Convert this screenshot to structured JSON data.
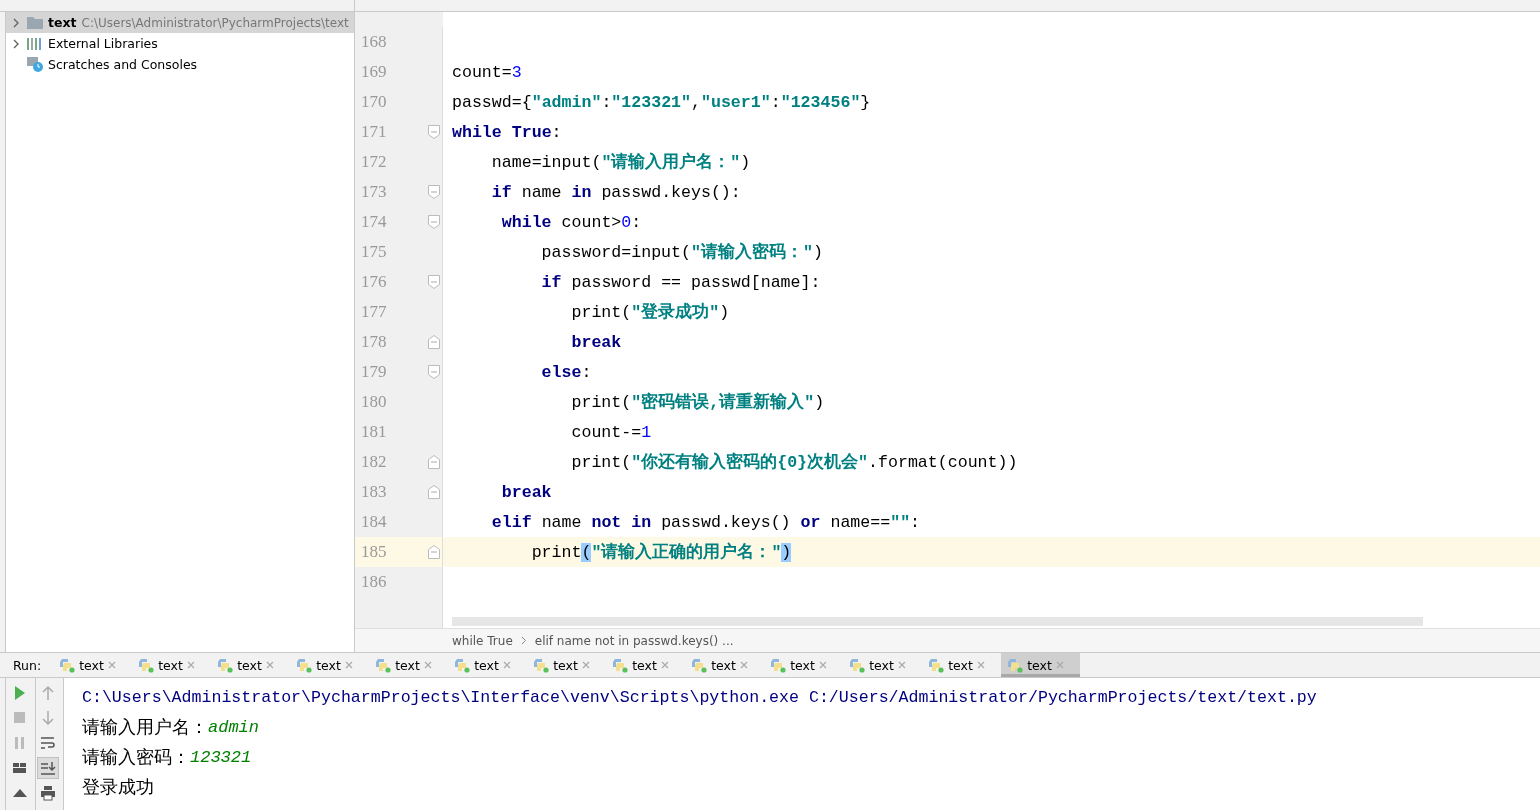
{
  "project_tree": {
    "items": [
      {
        "kind": "folder",
        "label": "text",
        "path": "C:\\Users\\Administrator\\PycharmProjects\\text",
        "expandable": true,
        "selected": true
      },
      {
        "kind": "libraries",
        "label": "External Libraries",
        "expandable": true,
        "selected": false
      },
      {
        "kind": "scratches",
        "label": "Scratches and Consoles",
        "expandable": false,
        "selected": false
      }
    ]
  },
  "editor": {
    "lines": [
      {
        "number": "168",
        "kind": "plain",
        "current": false
      },
      {
        "number": "169",
        "kind": "plain",
        "current": false,
        "tokens": [
          {
            "text": "count=",
            "kind": "plain"
          },
          {
            "text": "3",
            "kind": "num"
          }
        ]
      },
      {
        "number": "170",
        "kind": "plain",
        "current": false,
        "tokens": [
          {
            "text": "passwd={",
            "kind": "plain"
          },
          {
            "text": "\"admin\"",
            "kind": "str"
          },
          {
            "text": ":",
            "kind": "plain"
          },
          {
            "text": "\"123321\"",
            "kind": "str"
          },
          {
            "text": ",",
            "kind": "plain"
          },
          {
            "text": "\"user1\"",
            "kind": "str"
          },
          {
            "text": ":",
            "kind": "plain"
          },
          {
            "text": "\"123456\"",
            "kind": "str"
          },
          {
            "text": "}",
            "kind": "plain"
          }
        ]
      },
      {
        "number": "171",
        "kind": "fold-start",
        "current": false,
        "tokens": [
          {
            "text": "while",
            "kind": "kw"
          },
          {
            "text": " True",
            "kind": "kw"
          },
          {
            "text": ":",
            "kind": "plain"
          }
        ]
      },
      {
        "number": "172",
        "kind": "plain",
        "current": false,
        "tokens": [
          {
            "text": "    name=input(",
            "kind": "plain"
          },
          {
            "text": "\"请输入用户名：\"",
            "kind": "str"
          },
          {
            "text": ")",
            "kind": "plain"
          }
        ]
      },
      {
        "number": "173",
        "kind": "fold-start",
        "current": false,
        "tokens": [
          {
            "text": "    if",
            "kind": "kw"
          },
          {
            "text": " name ",
            "kind": "plain"
          },
          {
            "text": "in",
            "kind": "kw"
          },
          {
            "text": " passwd.keys():",
            "kind": "plain"
          }
        ]
      },
      {
        "number": "174",
        "kind": "fold-start",
        "current": false,
        "tokens": [
          {
            "text": "     while",
            "kind": "kw"
          },
          {
            "text": " count>",
            "kind": "plain"
          },
          {
            "text": "0",
            "kind": "num"
          },
          {
            "text": ":",
            "kind": "plain"
          }
        ]
      },
      {
        "number": "175",
        "kind": "plain",
        "current": false,
        "tokens": [
          {
            "text": "         password=input(",
            "kind": "plain"
          },
          {
            "text": "\"请输入密码：\"",
            "kind": "str"
          },
          {
            "text": ")",
            "kind": "plain"
          }
        ]
      },
      {
        "number": "176",
        "kind": "fold-start",
        "current": false,
        "tokens": [
          {
            "text": "         if",
            "kind": "kw"
          },
          {
            "text": " password == passwd[name]:",
            "kind": "plain"
          }
        ]
      },
      {
        "number": "177",
        "kind": "plain",
        "current": false,
        "tokens": [
          {
            "text": "            print(",
            "kind": "plain"
          },
          {
            "text": "\"登录成功\"",
            "kind": "str"
          },
          {
            "text": ")",
            "kind": "plain"
          }
        ]
      },
      {
        "number": "178",
        "kind": "fold-end",
        "current": false,
        "tokens": [
          {
            "text": "            break",
            "kind": "kw"
          }
        ]
      },
      {
        "number": "179",
        "kind": "fold-start",
        "current": false,
        "tokens": [
          {
            "text": "         else",
            "kind": "kw"
          },
          {
            "text": ":",
            "kind": "plain"
          }
        ]
      },
      {
        "number": "180",
        "kind": "plain",
        "current": false,
        "tokens": [
          {
            "text": "            print(",
            "kind": "plain"
          },
          {
            "text": "\"密码错误,请重新输入\"",
            "kind": "str"
          },
          {
            "text": ")",
            "kind": "plain"
          }
        ]
      },
      {
        "number": "181",
        "kind": "plain",
        "current": false,
        "tokens": [
          {
            "text": "            count-=",
            "kind": "plain"
          },
          {
            "text": "1",
            "kind": "num"
          }
        ]
      },
      {
        "number": "182",
        "kind": "fold-end",
        "current": false,
        "tokens": [
          {
            "text": "            print(",
            "kind": "plain"
          },
          {
            "text": "\"你还有输入密码的{0}次机会\"",
            "kind": "str"
          },
          {
            "text": ".format(count))",
            "kind": "plain"
          }
        ]
      },
      {
        "number": "183",
        "kind": "fold-end",
        "current": false,
        "tokens": [
          {
            "text": "     break",
            "kind": "kw"
          }
        ]
      },
      {
        "number": "184",
        "kind": "plain",
        "current": false,
        "tokens": [
          {
            "text": "    elif",
            "kind": "kw"
          },
          {
            "text": " name ",
            "kind": "plain"
          },
          {
            "text": "not",
            "kind": "kw"
          },
          {
            "text": " in",
            "kind": "kw"
          },
          {
            "text": " passwd.keys() ",
            "kind": "plain"
          },
          {
            "text": "or",
            "kind": "kw"
          },
          {
            "text": " name==",
            "kind": "plain"
          },
          {
            "text": "\"\"",
            "kind": "str"
          },
          {
            "text": ":",
            "kind": "plain"
          }
        ]
      },
      {
        "number": "185",
        "kind": "fold-end",
        "current": true,
        "tokens": [
          {
            "text": "        print",
            "kind": "plain"
          },
          {
            "text": "(",
            "kind": "match"
          },
          {
            "text": "\"请输入正确的用户名：\"",
            "kind": "str"
          },
          {
            "text": ")",
            "kind": "match"
          }
        ]
      },
      {
        "number": "186",
        "kind": "plain",
        "current": false
      }
    ],
    "breadcrumbs": [
      "while True",
      "elif name not in passwd.keys() ..."
    ]
  },
  "run": {
    "label": "Run:",
    "tabs": [
      {
        "label": "text",
        "selected": false
      },
      {
        "label": "text",
        "selected": false
      },
      {
        "label": "text",
        "selected": false
      },
      {
        "label": "text",
        "selected": false
      },
      {
        "label": "text",
        "selected": false
      },
      {
        "label": "text",
        "selected": false
      },
      {
        "label": "text",
        "selected": false
      },
      {
        "label": "text",
        "selected": false
      },
      {
        "label": "text",
        "selected": false
      },
      {
        "label": "text",
        "selected": false
      },
      {
        "label": "text",
        "selected": false
      },
      {
        "label": "text",
        "selected": false
      },
      {
        "label": "text",
        "selected": true
      }
    ],
    "tools": [
      {
        "kind": "run",
        "on": false
      },
      {
        "kind": "up",
        "on": false
      },
      {
        "kind": "stop",
        "on": false
      },
      {
        "kind": "down",
        "on": false
      },
      {
        "kind": "pause",
        "on": false
      },
      {
        "kind": "wrap",
        "on": false
      },
      {
        "kind": "layout",
        "on": false
      },
      {
        "kind": "scroll-end",
        "on": true
      },
      {
        "kind": "pin",
        "on": false
      },
      {
        "kind": "print",
        "on": false
      }
    ],
    "console": [
      [
        {
          "text": "C:\\Users\\Administrator\\PycharmProjects\\Interface\\venv\\Scripts\\python.exe C:/Users/Administrator/PycharmProjects/text/text.py",
          "kind": "command"
        }
      ],
      [
        {
          "text": "请输入用户名：",
          "kind": "output"
        },
        {
          "text": "admin",
          "kind": "input"
        }
      ],
      [
        {
          "text": "请输入密码：",
          "kind": "output"
        },
        {
          "text": "123321",
          "kind": "input"
        }
      ],
      [
        {
          "text": "登录成功",
          "kind": "output"
        }
      ]
    ]
  }
}
